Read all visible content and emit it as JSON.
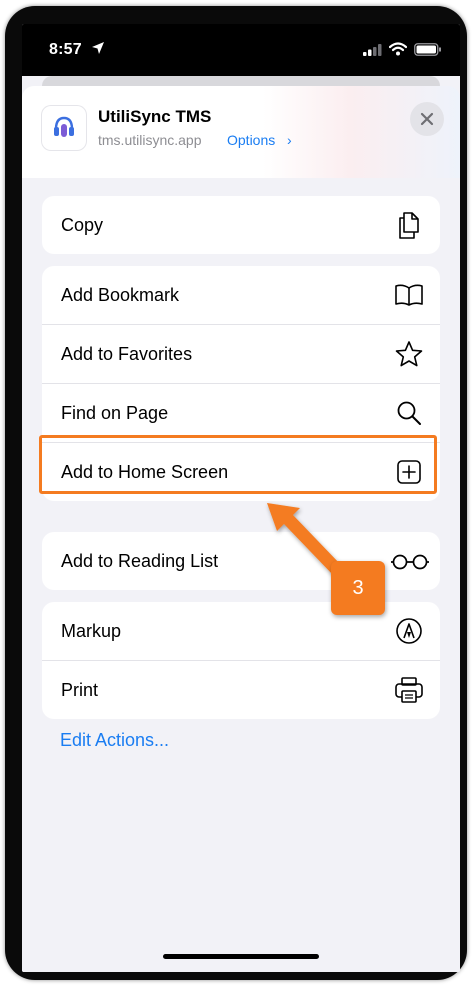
{
  "status_bar": {
    "time": "8:57"
  },
  "share_sheet": {
    "app_name": "UtiliSync TMS",
    "url": "tms.utilisync.app",
    "options_label": "Options",
    "options_chevron": "›"
  },
  "actions": {
    "group1": [
      {
        "label": "Copy",
        "icon": "copy-icon"
      }
    ],
    "group2": [
      {
        "label": "Add Bookmark",
        "icon": "book-icon"
      },
      {
        "label": "Add to Favorites",
        "icon": "star-icon"
      },
      {
        "label": "Find on Page",
        "icon": "search-icon"
      },
      {
        "label": "Add to Home Screen",
        "icon": "plus-square-icon"
      }
    ],
    "group3": [
      {
        "label": "Add to Reading List",
        "icon": "glasses-icon"
      }
    ],
    "group4": [
      {
        "label": "Markup",
        "icon": "markup-icon"
      },
      {
        "label": "Print",
        "icon": "printer-icon"
      }
    ],
    "edit_actions_label": "Edit Actions..."
  },
  "callout": {
    "step": "3",
    "color": "#f47b20"
  },
  "colors": {
    "link": "#1a7df2",
    "sheet_bg": "#f2f2f7",
    "highlight": "#f47b20"
  }
}
